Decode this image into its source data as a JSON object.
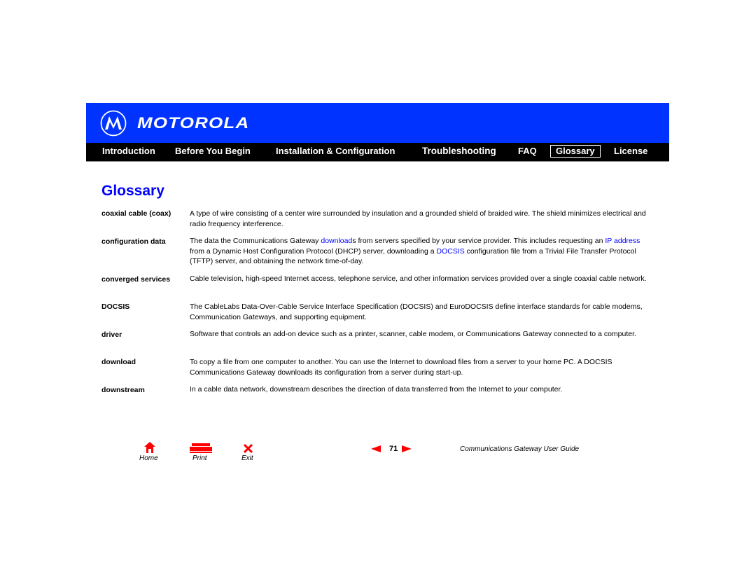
{
  "brand": {
    "name": "MOTOROLA",
    "logo_icon": "motorola-batwing-logo"
  },
  "nav": [
    {
      "label": "Introduction",
      "active": false
    },
    {
      "label": "Before You Begin",
      "active": false
    },
    {
      "label": "Installation & Configuration",
      "active": false
    },
    {
      "label": "Troubleshooting",
      "active": false
    },
    {
      "label": "FAQ",
      "active": false
    },
    {
      "label": "Glossary",
      "active": true
    },
    {
      "label": "License",
      "active": false
    }
  ],
  "page_title": "Glossary",
  "entries": [
    {
      "term": "coaxial cable (coax)",
      "definition": "A type of wire consisting of a center wire surrounded by insulation and a grounded shield of braided wire. The shield minimizes electrical and radio frequency interference."
    },
    {
      "term": "configuration data",
      "definition_parts": [
        "The data the Communications Gateway ",
        "download",
        "s from servers specified by your service provider. This includes requesting an ",
        "IP address",
        " from a Dynamic Host Configuration Protocol (DHCP) server, downloading a ",
        "DOCSIS",
        " configuration file from a Trivial File Transfer Protocol (TFTP) server, and obtaining the network time-of-day."
      ]
    },
    {
      "term": "converged services",
      "definition": "Cable television, high-speed Internet access, telephone service, and other information services provided over a single coaxial cable network."
    },
    {
      "term": "DOCSIS",
      "definition": "The CableLabs Data-Over-Cable Service Interface Specification (DOCSIS) and EuroDOCSIS define interface standards for cable modems, Communication Gateways, and supporting equipment."
    },
    {
      "term": "driver",
      "definition": "Software that controls an add-on device such as a printer, scanner, cable modem, or Communications Gateway connected to a computer."
    },
    {
      "term": "download",
      "definition": "To copy a file from one computer to another. You can use the Internet to download files from a server to your home PC. A DOCSIS Communications Gateway downloads its configuration from a server during start-up."
    },
    {
      "term": "downstream",
      "definition": "In a cable data network, downstream describes the direction of data transferred from the Internet to your computer."
    }
  ],
  "footer": {
    "home_label": "Home",
    "print_label": "Print",
    "exit_label": "Exit",
    "page_number": "71",
    "guide_title": "Communications Gateway User Guide",
    "icon_color": "#ff0000"
  },
  "colors": {
    "brand_blue": "#0033ff",
    "link_blue": "#0000ff",
    "nav_bg": "#000000"
  }
}
